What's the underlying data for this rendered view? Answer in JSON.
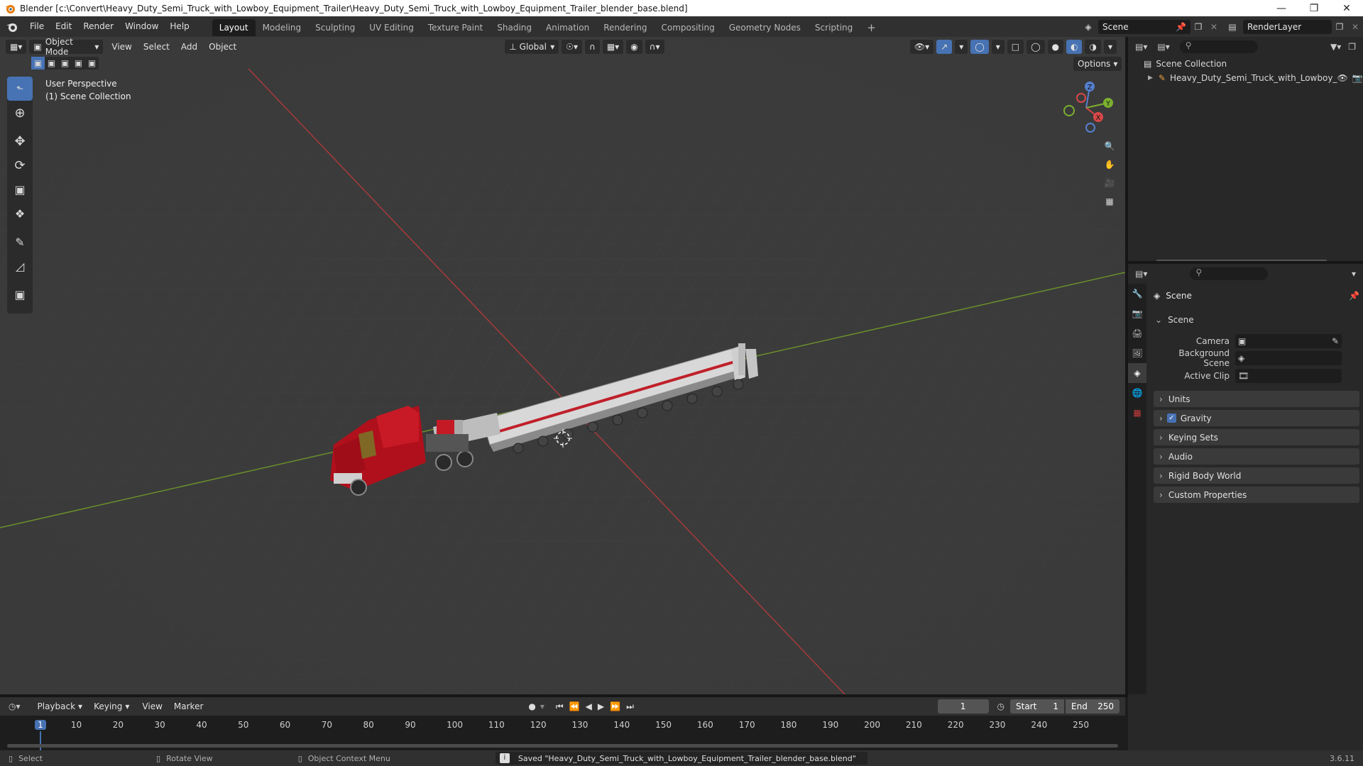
{
  "window": {
    "title": "Blender [c:\\Convert\\Heavy_Duty_Semi_Truck_with_Lowboy_Equipment_Trailer\\Heavy_Duty_Semi_Truck_with_Lowboy_Equipment_Trailer_blender_base.blend]",
    "controls": [
      "minimize-icon",
      "restore-icon",
      "close-icon"
    ]
  },
  "menu": {
    "items": [
      "File",
      "Edit",
      "Render",
      "Window",
      "Help"
    ]
  },
  "workspaces": {
    "tabs": [
      "Layout",
      "Modeling",
      "Sculpting",
      "UV Editing",
      "Texture Paint",
      "Shading",
      "Animation",
      "Rendering",
      "Compositing",
      "Geometry Nodes",
      "Scripting"
    ],
    "active": "Layout",
    "add_label": "+"
  },
  "scene_selector": {
    "value": "Scene"
  },
  "view_layer_selector": {
    "value": "RenderLayer"
  },
  "viewport": {
    "mode": "Object Mode",
    "header_menus": [
      "View",
      "Select",
      "Add",
      "Object"
    ],
    "transform_orientation": "Global",
    "options_label": "Options",
    "overlay_text_line1": "User Perspective",
    "overlay_text_line2": "(1) Scene Collection",
    "gizmo_axes": {
      "x": "X",
      "y": "Y",
      "z": "Z"
    },
    "colors": {
      "background": "#3b3b3b",
      "x_axis": "#c04040",
      "y_axis": "#6b9a2f",
      "truck_red": "#b0101c"
    }
  },
  "outliner": {
    "root": "Scene Collection",
    "items": [
      {
        "label": "Heavy_Duty_Semi_Truck_with_Lowboy_"
      }
    ]
  },
  "properties": {
    "context_title": "Scene",
    "panels": {
      "scene": {
        "title": "Scene",
        "camera_label": "Camera",
        "background_scene_label": "Background Scene",
        "active_clip_label": "Active Clip"
      },
      "collapsed": [
        "Units",
        "Gravity",
        "Keying Sets",
        "Audio",
        "Rigid Body World",
        "Custom Properties"
      ],
      "gravity_checked": true
    }
  },
  "timeline": {
    "menus": [
      "Playback",
      "Keying",
      "View",
      "Marker"
    ],
    "current_frame": "1",
    "start_label": "Start",
    "start_value": "1",
    "end_label": "End",
    "end_value": "250",
    "ruler_labels": [
      "1",
      "10",
      "20",
      "30",
      "40",
      "50",
      "60",
      "70",
      "80",
      "90",
      "100",
      "110",
      "120",
      "130",
      "140",
      "150",
      "160",
      "170",
      "180",
      "190",
      "200",
      "210",
      "220",
      "230",
      "240",
      "250"
    ]
  },
  "statusbar": {
    "select": "Select",
    "rotate": "Rotate View",
    "context_menu": "Object Context Menu",
    "message": "Saved \"Heavy_Duty_Semi_Truck_with_Lowboy_Equipment_Trailer_blender_base.blend\"",
    "version": "3.6.11"
  }
}
